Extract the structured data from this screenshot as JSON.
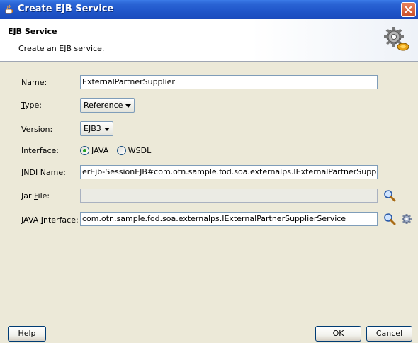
{
  "window": {
    "title": "Create EJB Service"
  },
  "header": {
    "title": "EJB Service",
    "description": "Create an EJB service."
  },
  "form": {
    "name": {
      "label_pre": "",
      "label_ul": "N",
      "label_post": "ame:",
      "value": "ExternalPartnerSupplier"
    },
    "type": {
      "label_pre": "",
      "label_ul": "T",
      "label_post": "ype:",
      "value": "Reference"
    },
    "version": {
      "label_pre": "",
      "label_ul": "V",
      "label_post": "ersion:",
      "value": "EJB3"
    },
    "interface": {
      "label_pre": "Inter",
      "label_ul": "f",
      "label_post": "ace:",
      "options": [
        {
          "pre": "J",
          "ul": "A",
          "post": "VA",
          "selected": true
        },
        {
          "pre": "W",
          "ul": "S",
          "post": "DL",
          "selected": false
        }
      ]
    },
    "jndi": {
      "label_pre": "",
      "label_ul": "J",
      "label_post": "NDI Name:",
      "value": "erEjb-SessionEJB#com.otn.sample.fod.soa.externalps.IExternalPartnerSupplierService"
    },
    "jar": {
      "label_pre": "Jar ",
      "label_ul": "F",
      "label_post": "ile:",
      "value": ""
    },
    "java_interface": {
      "label_pre": "JAVA ",
      "label_ul": "I",
      "label_post": "nterface:",
      "value": "com.otn.sample.fod.soa.externalps.IExternalPartnerSupplierService"
    }
  },
  "buttons": {
    "help": "Help",
    "ok": "OK",
    "cancel": "Cancel"
  },
  "icons": {
    "app": "coffee-cup-icon",
    "close": "close-icon",
    "header": "gears-icon",
    "search": "search-icon",
    "settings": "gear-icon"
  },
  "colors": {
    "titlebar": "#2a64d4",
    "dialog_bg": "#ece9d8",
    "close_button": "#d9623b"
  }
}
